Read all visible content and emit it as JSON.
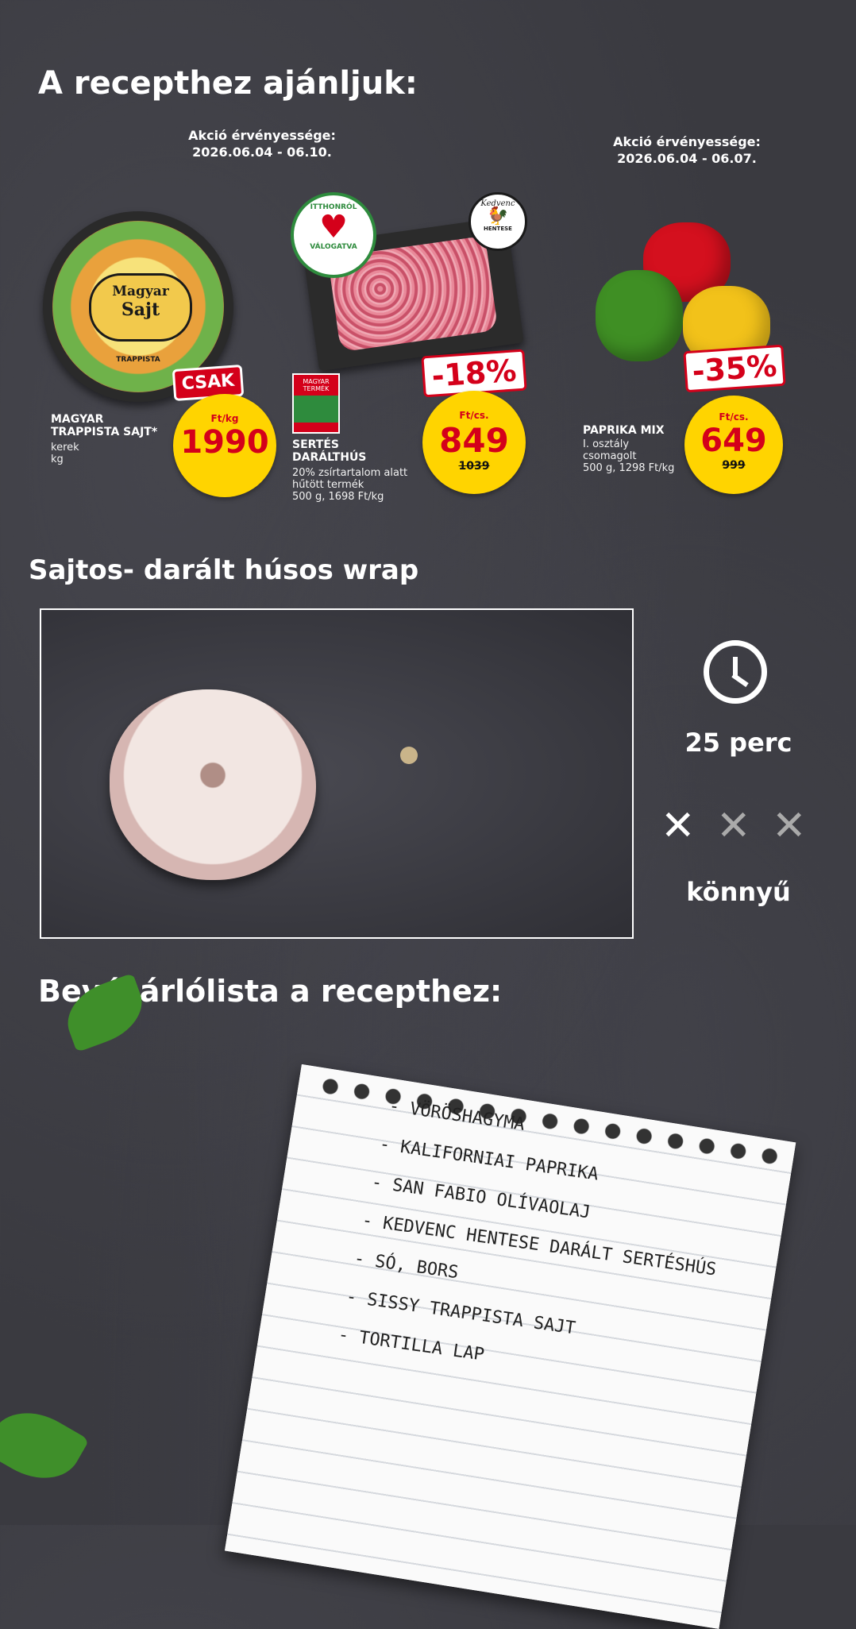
{
  "header": {
    "title": "A recepthez ajánljuk:"
  },
  "validity": [
    {
      "label": "Akció érvényessége:",
      "dates": "2026.06.04 - 06.10."
    },
    {
      "label": "Akció érvényessége:",
      "dates": "2026.06.04 - 06.07."
    }
  ],
  "products": [
    {
      "name_line1": "MAGYAR",
      "name_line2": "TRAPPISTA SAJT*",
      "desc_line1": "kerek",
      "desc_line2": "kg",
      "flag": "CSAK",
      "unit": "Ft/kg",
      "price": "1990",
      "package_brand": "Magyar",
      "package_name": "Sajt",
      "package_type": "TRAPPISTA"
    },
    {
      "name_line1": "SERTÉS",
      "name_line2": "DARÁLTHÚS",
      "desc_line1": "20% zsírtartalom alatt",
      "desc_line2": "hűtött termék",
      "desc_line3": "500 g, 1698 Ft/kg",
      "discount": "-18%",
      "unit": "Ft/cs.",
      "price": "849",
      "old_price": "1039",
      "badge_line1": "ITTHONRÓL",
      "badge_line2": "VÁLOGATVA",
      "origin_line1": "MAGYAR",
      "origin_line2": "TERMÉK",
      "butcher_line1": "Kedvenc",
      "butcher_line2": "HENTESE"
    },
    {
      "name_line1": "PAPRIKA MIX",
      "desc_line1": "I. osztály",
      "desc_line2": "csomagolt",
      "desc_line3": "500 g, 1298 Ft/kg",
      "discount": "-35%",
      "unit": "Ft/cs.",
      "price": "649",
      "old_price": "999"
    }
  ],
  "recipe": {
    "title": "Sajtos- darált húsos wrap",
    "time": "25 perc",
    "difficulty": "könnyű"
  },
  "shopping": {
    "title": "Bevásárlólista a recepthez:",
    "items": [
      "- VÖRÖSHAGYMA",
      "- KALIFORNIAI PAPRIKA",
      "- SAN FABIO OLÍVAOLAJ",
      "- KEDVENC HENTESE DARÁLT SERTÉSHÚS",
      "- SÓ, BORS",
      "- SISSY TRAPPISTA SAJT",
      "- TORTILLA LAP"
    ]
  },
  "colors": {
    "red": "#d4001a",
    "yellow": "#ffd400",
    "background": "#3a3a40"
  },
  "icons": [
    "clock-icon",
    "spoon-fork-icon",
    "heart-badge-icon",
    "hungarian-product-icon",
    "butcher-logo-icon"
  ]
}
